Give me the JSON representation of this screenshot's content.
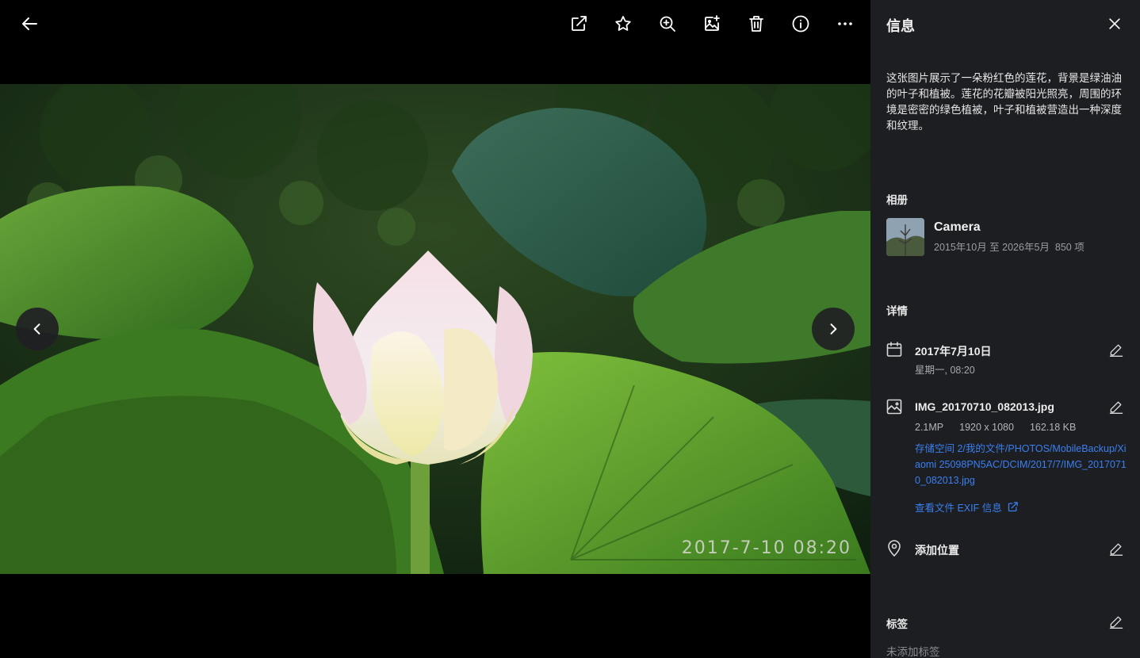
{
  "toolbar": {
    "back": "back-arrow-icon",
    "actions": [
      "open-external-icon",
      "star-icon",
      "zoom-in-icon",
      "add-to-album-icon",
      "delete-icon",
      "info-icon",
      "more-icon"
    ]
  },
  "photo": {
    "watermark": "2017-7-10 08:20",
    "subject": "pink-lotus-flower"
  },
  "panel": {
    "title": "信息",
    "description": "这张图片展示了一朵粉红色的莲花，背景是绿油油的叶子和植被。莲花的花瓣被阳光照亮，周围的环境是密密的绿色植被，叶子和植被营造出一种深度和纹理。",
    "album_label": "相册",
    "album": {
      "name": "Camera",
      "range": "2015年10月 至 2026年5月",
      "count": "850 项"
    },
    "details_label": "详情",
    "date": {
      "main": "2017年7月10日",
      "sub": "星期一, 08:20"
    },
    "file": {
      "name": "IMG_20170710_082013.jpg",
      "megapixels": "2.1MP",
      "resolution": "1920 x 1080",
      "size": "162.18 KB",
      "path": "存储空间 2/我的文件/PHOTOS/MobileBackup/Xiaomi 25098PN5AC/DCIM/2017/7/IMG_20170710_082013.jpg",
      "exif_link": "查看文件 EXIF 信息"
    },
    "location": {
      "label": "添加位置"
    },
    "tags_label": "标签",
    "tags_empty": "未添加标签"
  },
  "colors": {
    "panel_bg": "#1d1e21",
    "link": "#3b7ff0",
    "viewer_bg": "#000000"
  }
}
